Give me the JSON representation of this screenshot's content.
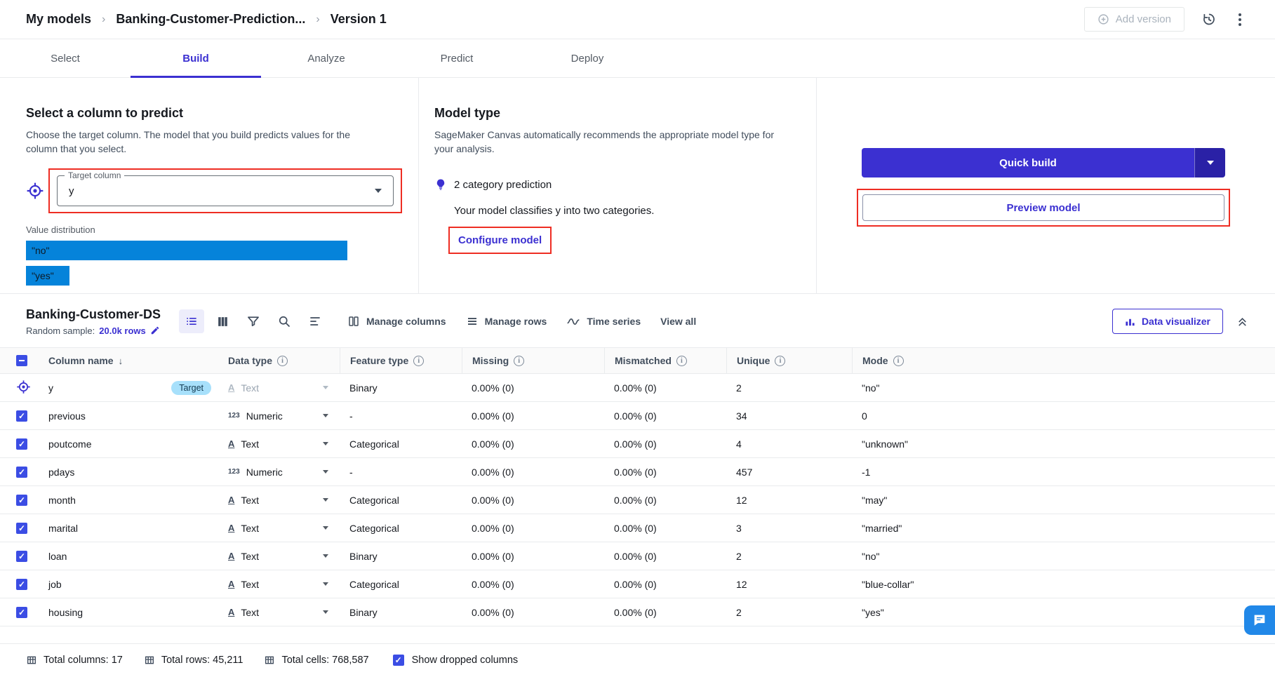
{
  "colors": {
    "accent": "#3b30d1",
    "accent-dark": "#2a21a6",
    "checkbox": "#3b4de4",
    "bar": "#0583da",
    "annotation": "#ee2d23",
    "pill-bg": "#a7e0fb",
    "pill-text": "#123a52",
    "chat": "#2188e8"
  },
  "topbar": {
    "breadcrumb": [
      "My models",
      "Banking-Customer-Prediction...",
      "Version 1"
    ],
    "add_version": "Add version"
  },
  "tabs": [
    {
      "label": "Select"
    },
    {
      "label": "Build",
      "active": true
    },
    {
      "label": "Analyze"
    },
    {
      "label": "Predict"
    },
    {
      "label": "Deploy"
    }
  ],
  "predict_panel": {
    "title": "Select a column to predict",
    "description": "Choose the target column. The model that you build predicts values for the column that you select.",
    "target_column_label": "Target column",
    "target_column_value": "y",
    "value_distribution_label": "Value distribution",
    "bars": [
      {
        "label": "\"no\"",
        "width_pct": 88
      },
      {
        "label": "\"yes\"",
        "width_pct": 12
      }
    ]
  },
  "model_panel": {
    "title": "Model type",
    "description": "SageMaker Canvas automatically recommends the appropriate model type for your analysis.",
    "recommendation": "2 category prediction",
    "detail": "Your model classifies y into two categories.",
    "configure_label": "Configure model"
  },
  "actions_panel": {
    "quick_build_label": "Quick build",
    "preview_model_label": "Preview model"
  },
  "dataset": {
    "name": "Banking-Customer-DS",
    "sample_label": "Random sample:",
    "sample_value": "20.0k rows",
    "manage_columns": "Manage columns",
    "manage_rows": "Manage rows",
    "time_series": "Time series",
    "view_all": "View all",
    "data_visualizer": "Data visualizer"
  },
  "table": {
    "columns": [
      {
        "label": "Column name",
        "sort": true
      },
      {
        "label": "Data type",
        "info": true
      },
      {
        "label": "Feature type",
        "info": true
      },
      {
        "label": "Missing",
        "info": true
      },
      {
        "label": "Mismatched",
        "info": true
      },
      {
        "label": "Unique",
        "info": true
      },
      {
        "label": "Mode",
        "info": true
      }
    ],
    "rows": [
      {
        "name": "y",
        "is_target": true,
        "target_badge": "Target",
        "type_icon": "A",
        "type_icon_underline": true,
        "type_label": "Text",
        "type_disabled": true,
        "feature_type": "Binary",
        "missing": "0.00% (0)",
        "mismatched": "0.00% (0)",
        "unique": "2",
        "mode": "\"no\""
      },
      {
        "name": "previous",
        "type_icon": "123",
        "type_label": "Numeric",
        "feature_type": "-",
        "missing": "0.00% (0)",
        "mismatched": "0.00% (0)",
        "unique": "34",
        "mode": "0"
      },
      {
        "name": "poutcome",
        "type_icon": "A",
        "type_icon_underline": true,
        "type_label": "Text",
        "feature_type": "Categorical",
        "missing": "0.00% (0)",
        "mismatched": "0.00% (0)",
        "unique": "4",
        "mode": "\"unknown\""
      },
      {
        "name": "pdays",
        "type_icon": "123",
        "type_label": "Numeric",
        "feature_type": "-",
        "missing": "0.00% (0)",
        "mismatched": "0.00% (0)",
        "unique": "457",
        "mode": "-1"
      },
      {
        "name": "month",
        "type_icon": "A",
        "type_icon_underline": true,
        "type_label": "Text",
        "feature_type": "Categorical",
        "missing": "0.00% (0)",
        "mismatched": "0.00% (0)",
        "unique": "12",
        "mode": "\"may\""
      },
      {
        "name": "marital",
        "type_icon": "A",
        "type_icon_underline": true,
        "type_label": "Text",
        "feature_type": "Categorical",
        "missing": "0.00% (0)",
        "mismatched": "0.00% (0)",
        "unique": "3",
        "mode": "\"married\""
      },
      {
        "name": "loan",
        "type_icon": "A",
        "type_icon_underline": true,
        "type_label": "Text",
        "feature_type": "Binary",
        "missing": "0.00% (0)",
        "mismatched": "0.00% (0)",
        "unique": "2",
        "mode": "\"no\""
      },
      {
        "name": "job",
        "type_icon": "A",
        "type_icon_underline": true,
        "type_label": "Text",
        "feature_type": "Categorical",
        "missing": "0.00% (0)",
        "mismatched": "0.00% (0)",
        "unique": "12",
        "mode": "\"blue-collar\""
      },
      {
        "name": "housing",
        "type_icon": "A",
        "type_icon_underline": true,
        "type_label": "Text",
        "feature_type": "Binary",
        "missing": "0.00% (0)",
        "mismatched": "0.00% (0)",
        "unique": "2",
        "mode": "\"yes\""
      }
    ]
  },
  "footer": {
    "total_columns": "Total columns: 17",
    "total_rows": "Total rows: 45,211",
    "total_cells": "Total cells: 768,587",
    "show_dropped_label": "Show dropped columns"
  }
}
